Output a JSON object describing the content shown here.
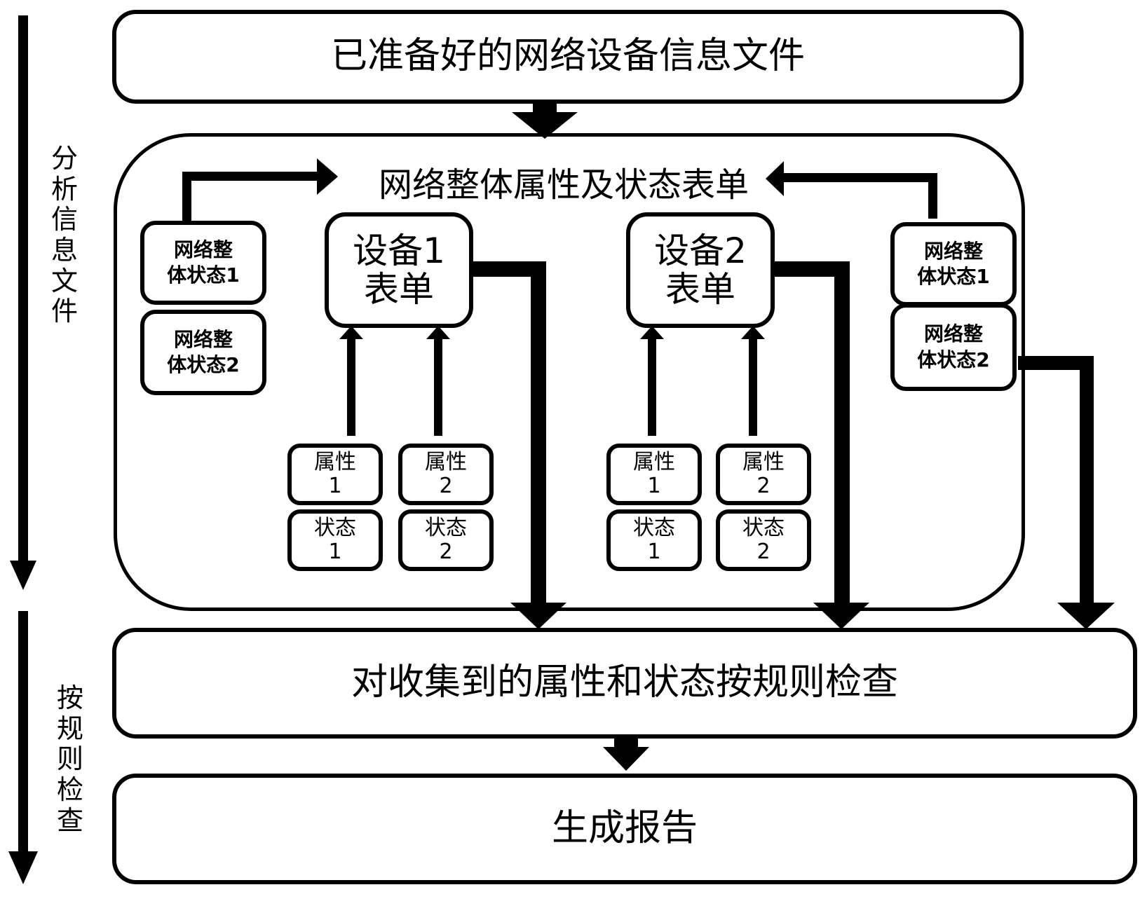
{
  "top_box": {
    "label": "已准备好的网络设备信息文件"
  },
  "container": {
    "title": "网络整体属性及状态表单",
    "left_network_states": [
      {
        "line1": "网络整",
        "line2": "体状态1"
      },
      {
        "line1": "网络整",
        "line2": "体状态2"
      }
    ],
    "right_network_states": [
      {
        "line1": "网络整",
        "line2": "体状态1"
      },
      {
        "line1": "网络整",
        "line2": "体状态2"
      }
    ],
    "devices": [
      {
        "line1": "设备1",
        "line2": "表单",
        "attributes": [
          {
            "line1": "属性",
            "line2": "1"
          },
          {
            "line1": "属性",
            "line2": "2"
          }
        ],
        "states": [
          {
            "line1": "状态",
            "line2": "1"
          },
          {
            "line1": "状态",
            "line2": "2"
          }
        ]
      },
      {
        "line1": "设备2",
        "line2": "表单",
        "attributes": [
          {
            "line1": "属性",
            "line2": "1"
          },
          {
            "line1": "属性",
            "line2": "2"
          }
        ],
        "states": [
          {
            "line1": "状态",
            "line2": "1"
          },
          {
            "line1": "状态",
            "line2": "2"
          }
        ]
      }
    ]
  },
  "check_box": {
    "label": "对收集到的属性和状态按规则检查"
  },
  "report_box": {
    "label": "生成报告"
  },
  "phases": [
    {
      "label": [
        "分",
        "析",
        "信",
        "息",
        "文",
        "件"
      ]
    },
    {
      "label": [
        "按",
        "规",
        "则",
        "检",
        "查"
      ]
    }
  ]
}
